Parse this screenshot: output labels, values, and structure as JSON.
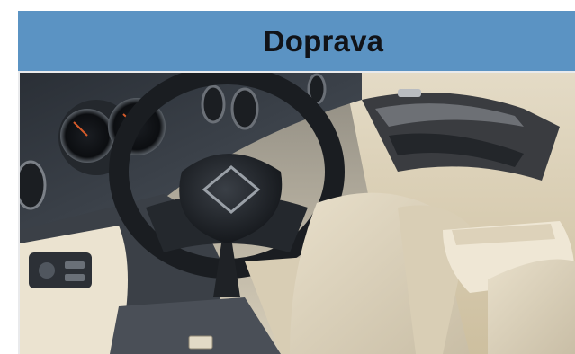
{
  "header": {
    "title": "Doprava"
  },
  "image": {
    "subject": "car-interior-photo"
  },
  "colors": {
    "header_bg": "#5b93c3",
    "title_text": "#111318",
    "frame_border": "#e9eaec"
  }
}
